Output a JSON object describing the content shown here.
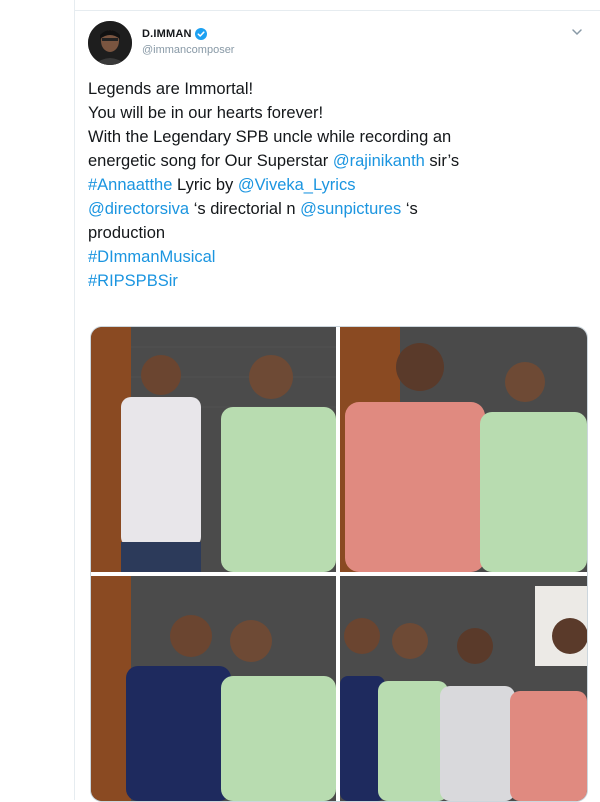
{
  "account": {
    "display_name": "D.IMMAN",
    "handle": "@immancomposer"
  },
  "tweet": {
    "line1": "Legends are Immortal!",
    "line2": "You will be in our hearts forever!",
    "line3": "With the Legendary SPB uncle while recording an",
    "line4_prefix": "energetic song for Our Superstar ",
    "line4_mention": "@rajinikanth",
    "line4_suffix": " sir’s",
    "line5_hashtag": "#Annaatthe",
    "line5_middle": " Lyric by ",
    "line5_mention": "@Viveka_Lyrics",
    "line6_mention1": "@directorsiva",
    "line6_middle": " ‘s directorial n ",
    "line6_mention2": "@sunpictures",
    "line6_suffix": " ‘s",
    "line7": "production",
    "line8_hashtag": "#DImmanMusical",
    "line9_hashtag": "#RIPSPBSir"
  },
  "icons": {
    "verified": "verified-badge-icon",
    "caret": "chevron-down-icon"
  },
  "colors": {
    "link": "#1b95e0",
    "text": "#14171a",
    "muted": "#8899a6",
    "border": "#e6ecf0"
  }
}
